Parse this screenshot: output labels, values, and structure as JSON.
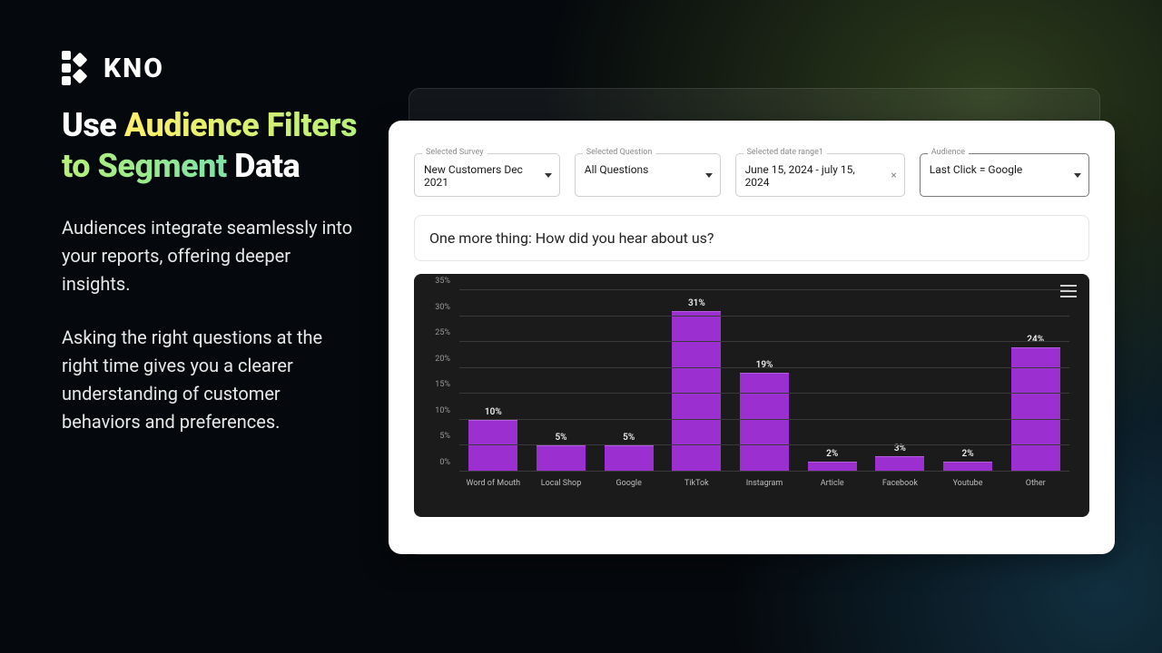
{
  "brand": {
    "name": "KNO"
  },
  "marketing": {
    "headline_plain": "Use ",
    "headline_accent": "Audience Filters to Segment",
    "headline_trail": " Data",
    "para1": "Audiences integrate seamlessly into your reports, offering deeper insights.",
    "para2": "Asking the right questions at the right time gives you a clearer understanding of customer behaviors and preferences."
  },
  "filters": {
    "survey": {
      "label": "Selected Survey",
      "value": "New Customers Dec 2021"
    },
    "question": {
      "label": "Selected Question",
      "value": "All Questions"
    },
    "date": {
      "label": "Selected date range1",
      "value": "June 15, 2024 - july 15, 2024"
    },
    "audience": {
      "label": "Audience",
      "value": "Last Click = Google"
    }
  },
  "question_box": "One more thing: How did you hear about us?",
  "chart_data": {
    "type": "bar",
    "title": "",
    "xlabel": "",
    "ylabel": "",
    "ylim": [
      0,
      35
    ],
    "yticks": [
      0,
      5,
      10,
      15,
      20,
      25,
      30,
      35
    ],
    "categories": [
      "Word of Mouth",
      "Local Shop",
      "Google",
      "TikTok",
      "Instagram",
      "Article",
      "Facebook",
      "Youtube",
      "Other"
    ],
    "values": [
      10,
      5,
      5,
      31,
      19,
      2,
      3,
      2,
      24
    ],
    "value_labels": [
      "10%",
      "5%",
      "5%",
      "31%",
      "19%",
      "2%",
      "3%",
      "2%",
      "24%"
    ],
    "bar_color": "#9b2fcf"
  }
}
